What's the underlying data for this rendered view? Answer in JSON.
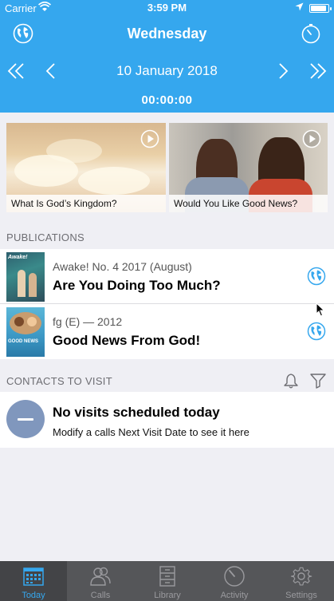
{
  "status_bar": {
    "carrier": "Carrier",
    "time": "3:59 PM",
    "battery_level": 0.9
  },
  "header": {
    "day": "Wednesday",
    "date": "10 January 2018",
    "timer": "00:00:00"
  },
  "videos": [
    {
      "caption": "What Is God’s Kingdom?"
    },
    {
      "caption": "Would You Like Good News?"
    }
  ],
  "publications": {
    "section_title": "PUBLICATIONS",
    "items": [
      {
        "meta": "Awake! No. 4 2017 (August)",
        "title": "Are You Doing Too Much?",
        "cover_label": "Awake!"
      },
      {
        "meta": "fg (E) — 2012",
        "title": "Good News From God!",
        "cover_label": "GOOD NEWS"
      }
    ]
  },
  "contacts": {
    "section_title": "CONTACTS TO VISIT",
    "empty_title": "No visits scheduled today",
    "empty_hint": "Modify a calls Next Visit Date to see it here"
  },
  "tabs": [
    {
      "label": "Today",
      "active": true
    },
    {
      "label": "Calls",
      "active": false
    },
    {
      "label": "Library",
      "active": false
    },
    {
      "label": "Activity",
      "active": false
    },
    {
      "label": "Settings",
      "active": false
    }
  ],
  "colors": {
    "accent": "#35a7ee",
    "tabbar": "#555659",
    "no_visit_circle": "#8097bd"
  }
}
